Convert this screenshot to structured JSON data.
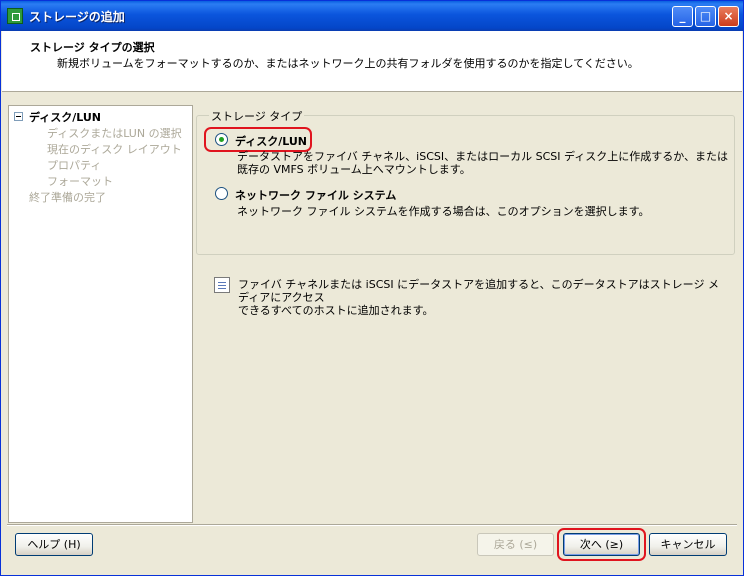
{
  "window": {
    "title": "ストレージの追加"
  },
  "header": {
    "title": "ストレージ タイプの選択",
    "description": "新規ボリュームをフォーマットするのか、またはネットワーク上の共有フォルダを使用するのかを指定してください。"
  },
  "nav": {
    "items": [
      {
        "label": "ディスク/LUN"
      },
      {
        "label": "ディスクまたはLUN の選択"
      },
      {
        "label": "現在のディスク レイアウト"
      },
      {
        "label": "プロパティ"
      },
      {
        "label": "フォーマット"
      },
      {
        "label": "終了準備の完了"
      }
    ]
  },
  "storage_type": {
    "legend": "ストレージ タイプ",
    "options": [
      {
        "label": "ディスク/LUN",
        "desc_line1": "データストアをファイバ チャネル、iSCSI、またはローカル SCSI ディスク上に作成するか、または",
        "desc_line2": "既存の VMFS ボリューム上へマウントします。",
        "selected": true
      },
      {
        "label": "ネットワーク ファイル システム",
        "desc_line1": "ネットワーク ファイル システムを作成する場合は、このオプションを選択します。",
        "selected": false
      }
    ]
  },
  "info": {
    "line1": "ファイバ チャネルまたは iSCSI にデータストアを追加すると、このデータストアはストレージ メディアにアクセス",
    "line2": "できるすべてのホストに追加されます。"
  },
  "footer": {
    "help": "ヘルプ (H)",
    "back": "戻る (≤)",
    "next": "次へ (≥)",
    "cancel": "キャンセル"
  },
  "colors": {
    "titlebar": "#0b55dd",
    "highlight": "#e0141e",
    "dialog_bg": "#ece9d8"
  },
  "icons": [
    "app-icon",
    "minimize-icon",
    "maximize-icon",
    "close-icon",
    "collapse-icon",
    "info-icon"
  ]
}
